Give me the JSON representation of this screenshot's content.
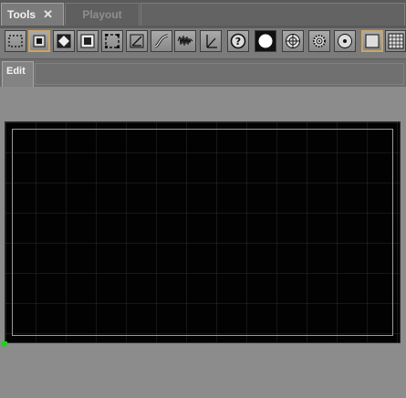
{
  "panel_tabs": [
    {
      "label": "Tools",
      "close_glyph": "✕",
      "active": true
    },
    {
      "label": "Playout",
      "active": false
    }
  ],
  "toolbar": {
    "tools": [
      {
        "icon": "marquee-select-icon",
        "selected": false
      },
      {
        "icon": "square-bracket-icon",
        "selected": true
      },
      {
        "icon": "diamond-in-square-icon",
        "selected": false
      },
      {
        "icon": "filled-square-icon",
        "selected": false
      },
      {
        "icon": "dashed-square-icon",
        "selected": false
      },
      {
        "icon": "angle-line-icon",
        "selected": false
      },
      {
        "icon": "curve-icon",
        "selected": false
      },
      {
        "icon": "waveform-icon",
        "selected": false
      },
      {
        "icon": "vector-axis-icon",
        "selected": false
      },
      {
        "icon": "help-icon",
        "selected": false,
        "glyph": "?"
      },
      {
        "icon": "white-circle-icon",
        "selected": false
      },
      {
        "icon": "target-icon",
        "selected": false
      },
      {
        "icon": "gear-icon",
        "selected": false
      },
      {
        "icon": "ring-icon",
        "selected": false
      },
      {
        "icon": "plain-square-icon",
        "selected": true
      },
      {
        "icon": "grid-icon",
        "selected": false
      }
    ]
  },
  "edit_tab": {
    "label": "Edit"
  },
  "canvas": {
    "background": "#020202",
    "origin_marker_color": "#1fd11f"
  }
}
